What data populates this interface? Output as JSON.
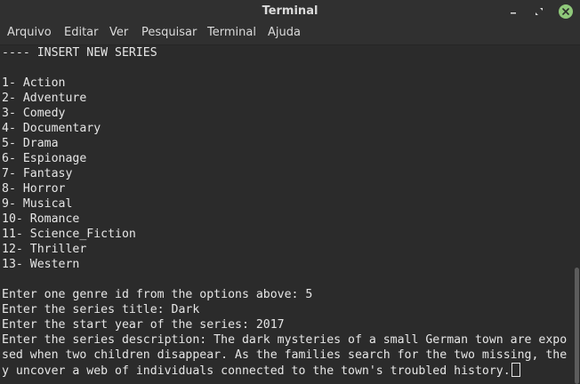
{
  "window": {
    "title": "Terminal",
    "colors": {
      "titlebar": "#303030",
      "background": "#2b2b2b",
      "text": "#e6e6e6",
      "close_button": "#8fc87a"
    }
  },
  "menu": {
    "items": [
      "Arquivo",
      "Editar",
      "Ver",
      "Pesquisar",
      "Terminal",
      "Ajuda"
    ]
  },
  "terminal": {
    "lines": [
      "---- INSERT NEW SERIES",
      "",
      "1- Action",
      "2- Adventure",
      "3- Comedy",
      "4- Documentary",
      "5- Drama",
      "6- Espionage",
      "7- Fantasy",
      "8- Horror",
      "9- Musical",
      "10- Romance",
      "11- Science_Fiction",
      "12- Thriller",
      "13- Western",
      "",
      "Enter one genre id from the options above: 5",
      "Enter the series title: Dark",
      "Enter the start year of the series: 2017",
      "Enter the series description: The dark mysteries of a small German town are expo",
      "sed when two children disappear. As the families search for the two missing, the",
      "y uncover a web of individuals connected to the town's troubled history."
    ]
  }
}
